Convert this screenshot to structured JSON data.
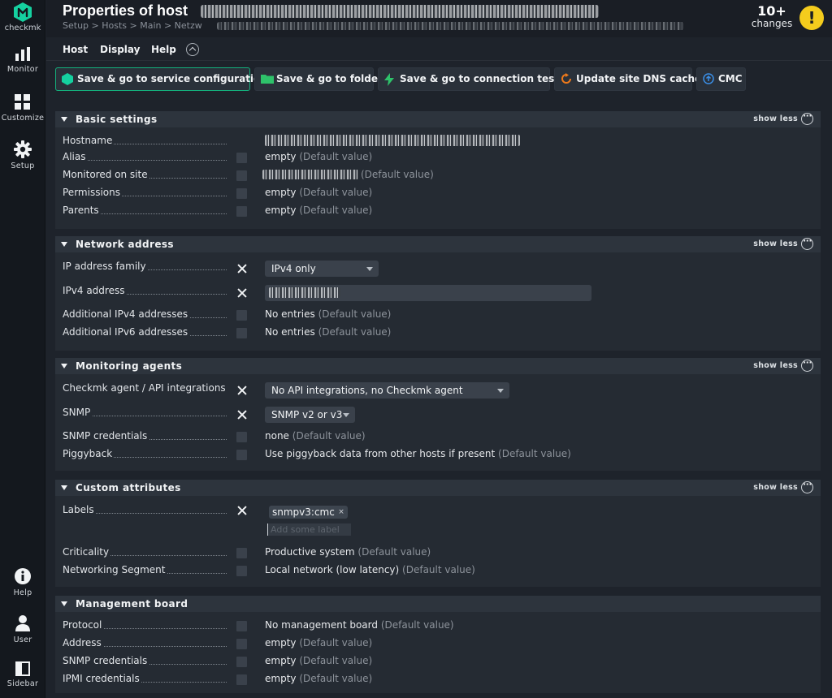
{
  "sidebar": {
    "logo_text": "checkmk",
    "items": [
      {
        "label": "Monitor",
        "icon": "monitor-icon"
      },
      {
        "label": "Customize",
        "icon": "customize-icon"
      },
      {
        "label": "Setup",
        "icon": "setup-icon"
      },
      {
        "label": "Help",
        "icon": "help-icon"
      },
      {
        "label": "User",
        "icon": "user-icon"
      },
      {
        "label": "Sidebar",
        "icon": "sidebar-icon"
      }
    ]
  },
  "header": {
    "title": "Properties of host",
    "breadcrumb": "Setup > Hosts > Main > Netzw",
    "changes_count": "10+",
    "changes_label": "changes",
    "warning_glyph": "!"
  },
  "menu": {
    "items": [
      "Host",
      "Display",
      "Help"
    ]
  },
  "toolbar": {
    "buttons": [
      {
        "label": "Save & go to service configuration",
        "icon": "save-green-icon"
      },
      {
        "label": "Save & go to folder",
        "icon": "folder-icon"
      },
      {
        "label": "Save & go to connection tests",
        "icon": "bolt-icon"
      },
      {
        "label": "Update site DNS cache",
        "icon": "refresh-icon"
      },
      {
        "label": "CMC",
        "icon": "cmc-icon"
      }
    ]
  },
  "common": {
    "show_less": "show less",
    "default_value": "(Default value)"
  },
  "sections": {
    "basic": {
      "title": "Basic settings",
      "rows": [
        {
          "label": "Hostname"
        },
        {
          "label": "Alias",
          "value": "empty"
        },
        {
          "label": "Monitored on site"
        },
        {
          "label": "Permissions",
          "value": "empty"
        },
        {
          "label": "Parents",
          "value": "empty"
        }
      ]
    },
    "network": {
      "title": "Network address",
      "rows": [
        {
          "label": "IP address family",
          "value": "IPv4 only"
        },
        {
          "label": "IPv4 address"
        },
        {
          "label": "Additional IPv4 addresses",
          "value": "No entries"
        },
        {
          "label": "Additional IPv6 addresses",
          "value": "No entries"
        }
      ]
    },
    "agents": {
      "title": "Monitoring agents",
      "rows": [
        {
          "label": "Checkmk agent / API integrations",
          "value": "No API integrations, no Checkmk agent"
        },
        {
          "label": "SNMP",
          "value": "SNMP v2 or v3"
        },
        {
          "label": "SNMP credentials",
          "value": "none"
        },
        {
          "label": "Piggyback",
          "value": "Use piggyback data from other hosts if present"
        }
      ]
    },
    "custom": {
      "title": "Custom attributes",
      "rows": [
        {
          "label": "Labels",
          "tag": "snmpv3:cmc",
          "tag_close": "×",
          "placeholder": "Add some label"
        },
        {
          "label": "Criticality",
          "value": "Productive system"
        },
        {
          "label": "Networking Segment",
          "value": "Local network (low latency)"
        }
      ]
    },
    "mgmt": {
      "title": "Management board",
      "rows": [
        {
          "label": "Protocol",
          "value": "No management board"
        },
        {
          "label": "Address",
          "value": "empty"
        },
        {
          "label": "SNMP credentials",
          "value": "empty"
        },
        {
          "label": "IPMI credentials",
          "value": "empty"
        }
      ]
    }
  }
}
